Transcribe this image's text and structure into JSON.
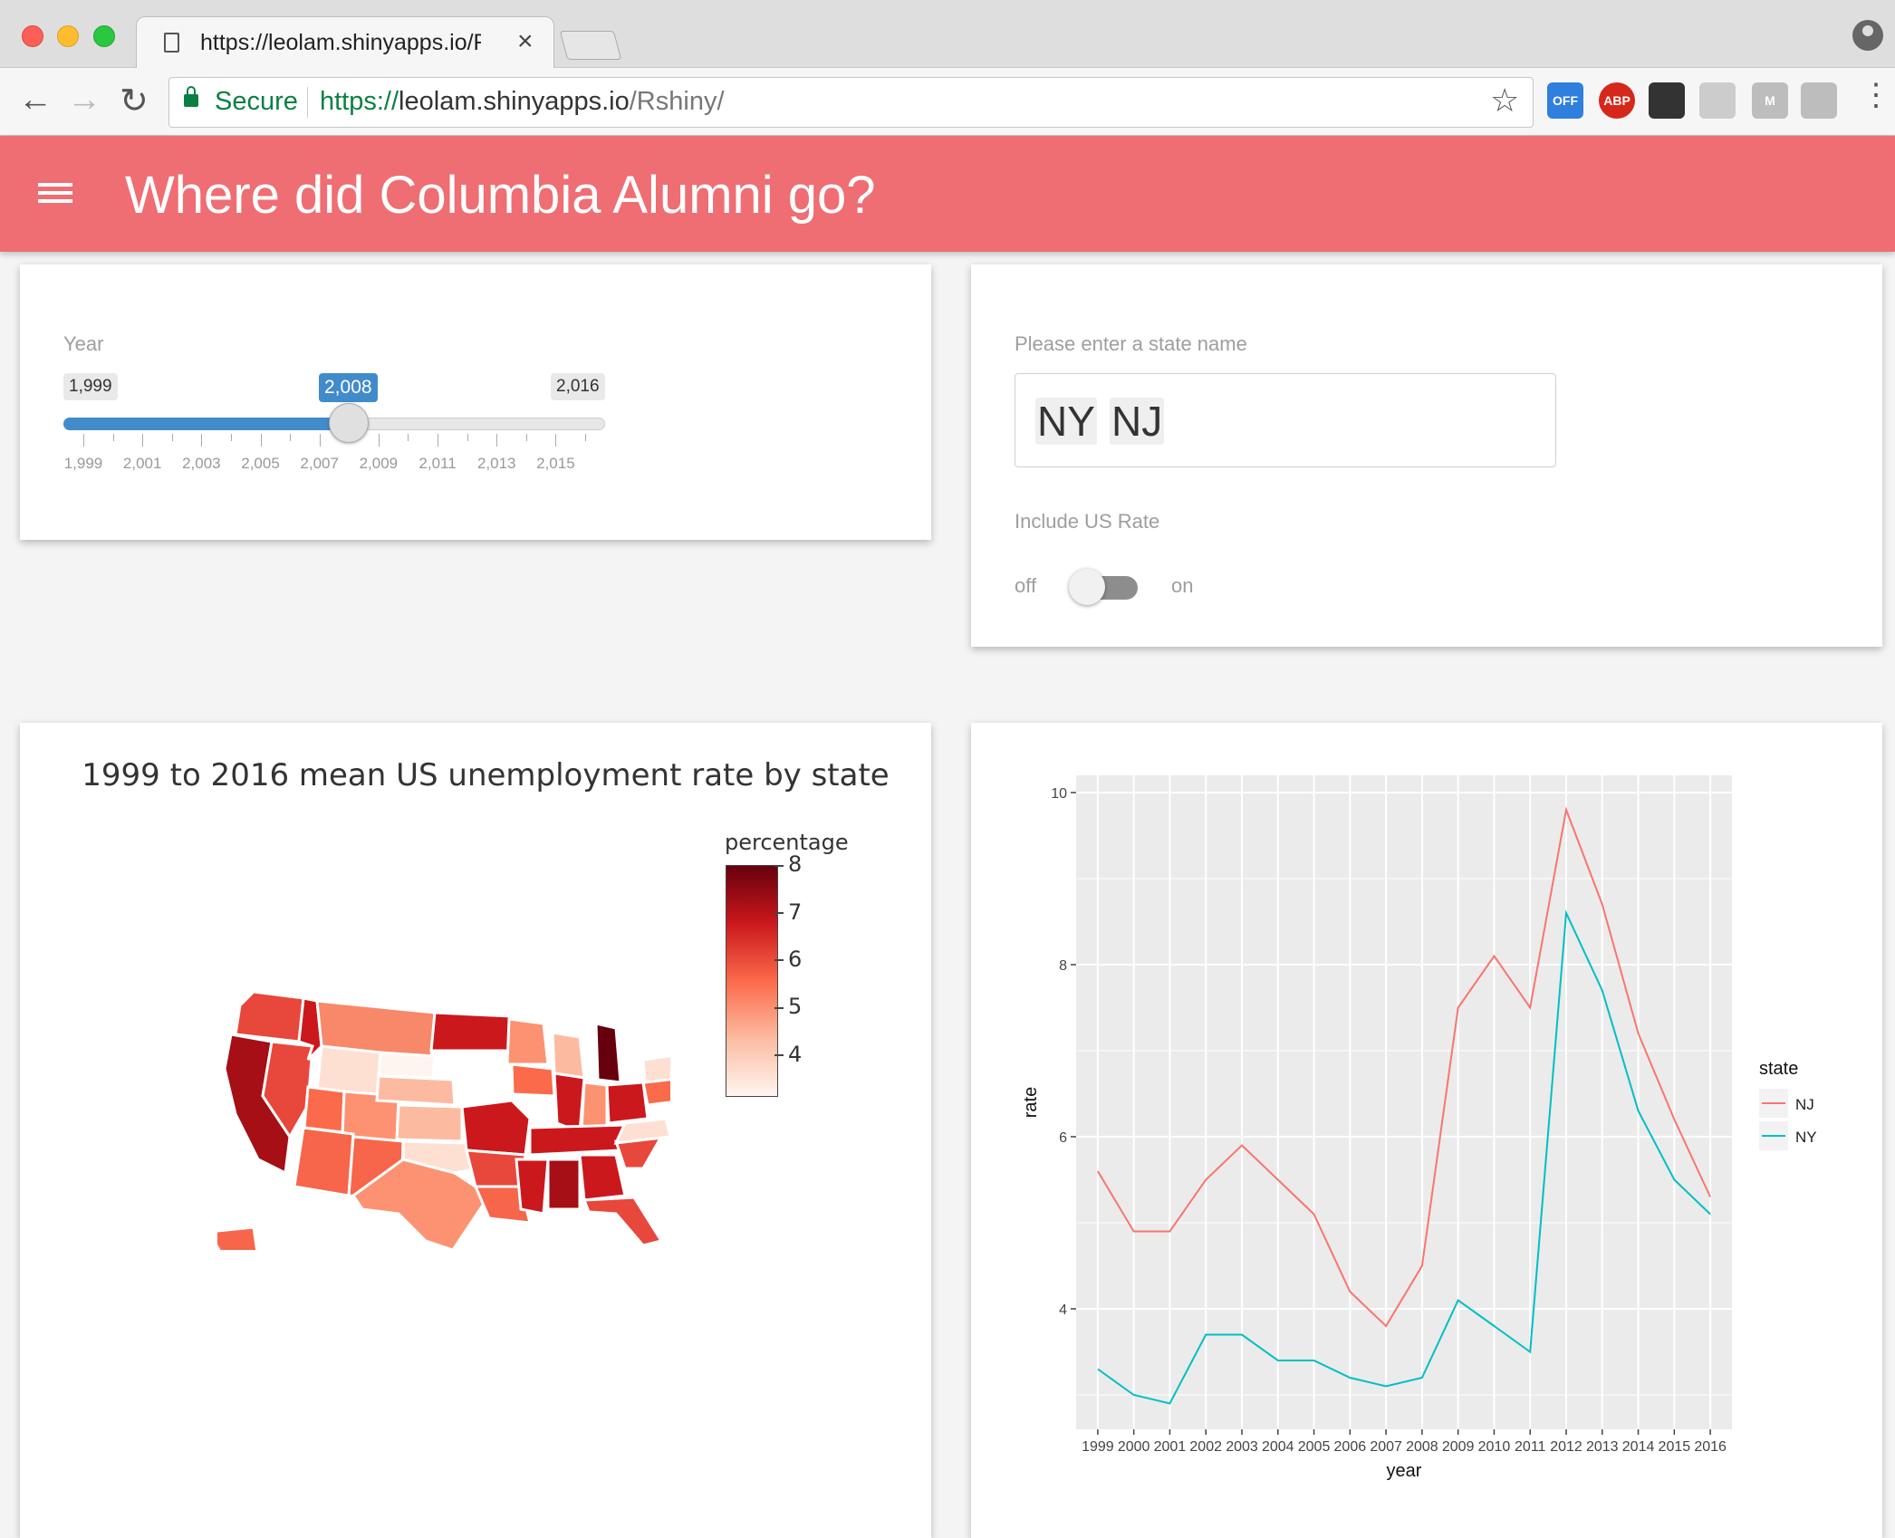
{
  "browser": {
    "tab_title": "https://leolam.shinyapps.io/Rshiny/",
    "tab_close": "×",
    "secure_label": "Secure",
    "url_scheme": "https://",
    "url_host": "leolam.shinyapps.io",
    "url_path": "/Rshiny/",
    "extensions": [
      {
        "name": "OFF",
        "color": "#2f7fde"
      },
      {
        "name": "ABP",
        "color": "#d6281a"
      },
      {
        "name": "",
        "color": "#333333"
      },
      {
        "name": "",
        "color": "#cccccc"
      },
      {
        "name": "M",
        "color": "#bdbdbd"
      },
      {
        "name": "",
        "color": "#bdbdbd"
      }
    ]
  },
  "app": {
    "title": "Where did Columbia Alumni go?",
    "accent": "#ee6e73"
  },
  "year_slider": {
    "label": "Year",
    "min_label": "1,999",
    "max_label": "2,016",
    "value_label": "2,008",
    "min": 1999,
    "max": 2016,
    "value": 2008,
    "tick_labels": [
      "1,999",
      "2,001",
      "2,003",
      "2,005",
      "2,007",
      "2,009",
      "2,011",
      "2,013",
      "2,015"
    ]
  },
  "state_input": {
    "label": "Please enter a state name",
    "tokens": [
      "NY",
      "NJ"
    ],
    "toggle_label": "Include US Rate",
    "off_label": "off",
    "on_label": "on",
    "toggle_on": false
  },
  "map": {
    "title": "1999 to 2016 mean US unemployment rate by state",
    "colorbar_title": "percentage",
    "colorbar_ticks": [
      "8",
      "7",
      "6",
      "5",
      "4"
    ],
    "colorbar_range": [
      3.1,
      8
    ]
  },
  "chart_data": {
    "type": "line",
    "x": [
      1999,
      2000,
      2001,
      2002,
      2003,
      2004,
      2005,
      2006,
      2007,
      2008,
      2009,
      2010,
      2011,
      2012,
      2013,
      2014,
      2015,
      2016
    ],
    "series": [
      {
        "name": "NJ",
        "color": "#f8766d",
        "values": [
          5.6,
          4.9,
          4.9,
          5.5,
          5.9,
          5.5,
          5.1,
          4.2,
          3.8,
          4.5,
          7.5,
          8.1,
          7.5,
          9.8,
          8.7,
          7.2,
          6.2,
          5.3
        ]
      },
      {
        "name": "NY",
        "color": "#00bfc4",
        "values": [
          3.3,
          3.0,
          2.9,
          3.7,
          3.7,
          3.4,
          3.4,
          3.2,
          3.1,
          3.2,
          4.1,
          3.8,
          3.5,
          8.6,
          7.7,
          6.3,
          5.5,
          5.1
        ]
      }
    ],
    "xlabel": "year",
    "ylabel": "rate",
    "x_tick_labels": [
      "1999",
      "2000",
      "2001",
      "2002",
      "2003",
      "2004",
      "2005",
      "2006",
      "2007",
      "2008",
      "2009",
      "2010",
      "2011",
      "2012",
      "2013",
      "2014",
      "2015",
      "2016"
    ],
    "y_ticks": [
      4,
      6,
      8,
      10
    ],
    "y_tick_labels": [
      "4",
      "6",
      "8",
      "10"
    ],
    "ylim": [
      2.6,
      10.2
    ],
    "legend_title": "state",
    "legend_position": "right",
    "grid": true
  }
}
